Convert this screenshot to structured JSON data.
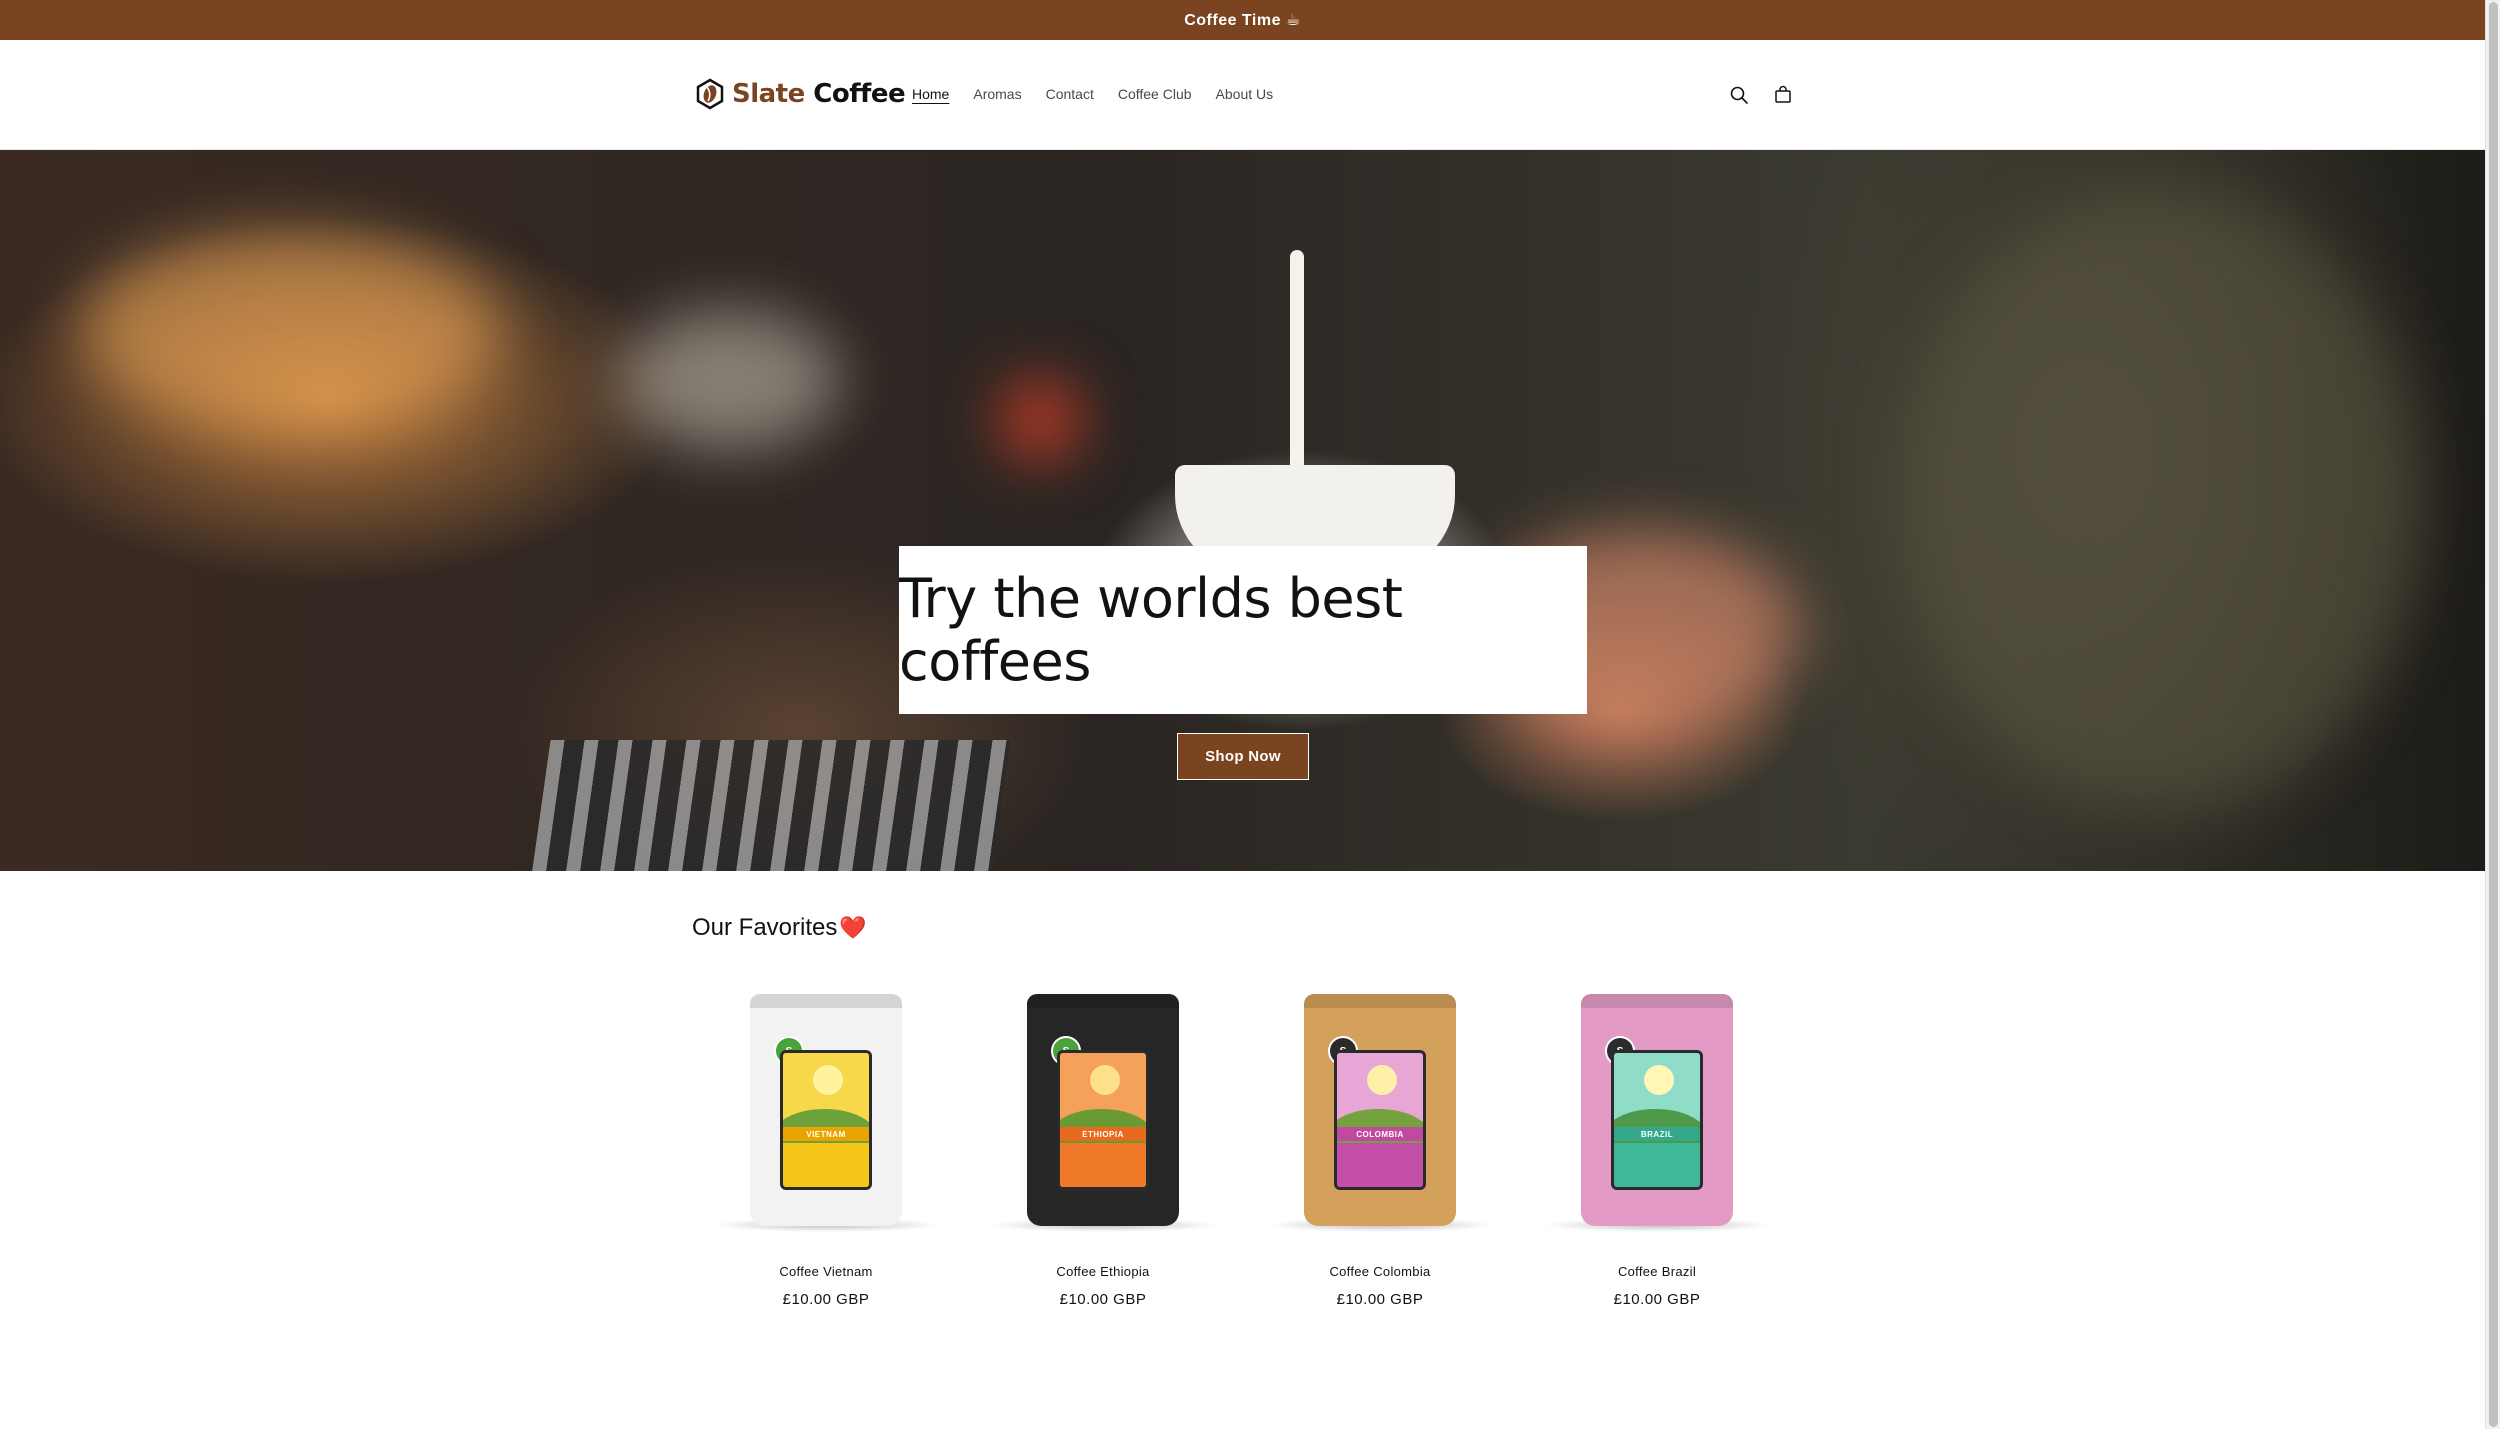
{
  "announcement": {
    "text": "Coffee Time ☕"
  },
  "header": {
    "logo": {
      "brand_accent": "Slate",
      "brand_main": " Coffee"
    },
    "nav": [
      {
        "label": "Home",
        "active": true
      },
      {
        "label": "Aromas",
        "active": false
      },
      {
        "label": "Contact",
        "active": false
      },
      {
        "label": "Coffee Club",
        "active": false
      },
      {
        "label": "About Us",
        "active": false
      }
    ],
    "icons": {
      "search": "search-icon",
      "cart": "cart-icon"
    }
  },
  "hero": {
    "title": "Try the worlds best coffees",
    "button_label": "Shop Now"
  },
  "favorites": {
    "title": "Our Favorites",
    "emoji": "❤️",
    "products": [
      {
        "name": "Coffee Vietnam",
        "price": "£10.00 GBP",
        "label_text": "VIETNAM",
        "bag_color": "#f2f2f2",
        "accent": "#f5c518",
        "sky": "#f7d84a",
        "sun": "#fff3a0",
        "hill": "#6da23a",
        "band": "#e9a400",
        "badge": "#4aa33a"
      },
      {
        "name": "Coffee Ethiopia",
        "price": "£10.00 GBP",
        "label_text": "ETHIOPIA",
        "bag_color": "#262626",
        "accent": "#f07a2a",
        "sky": "#f6a15a",
        "sun": "#ffe08a",
        "hill": "#6a9a34",
        "band": "#e86a1f",
        "badge": "#4aa33a"
      },
      {
        "name": "Coffee Colombia",
        "price": "£10.00 GBP",
        "label_text": "COLOMBIA",
        "bag_color": "#d3a15c",
        "accent": "#c44fa8",
        "sky": "#e7a6d6",
        "sun": "#fff0a8",
        "hill": "#74a23c",
        "band": "#c14aa0",
        "badge": "#2b2b2b"
      },
      {
        "name": "Coffee Brazil",
        "price": "£10.00 GBP",
        "label_text": "BRAZIL",
        "bag_color": "#e39bc6",
        "accent": "#3fb89a",
        "sky": "#8fdcc8",
        "sun": "#fff6b8",
        "hill": "#4f9a4a",
        "band": "#33a98a",
        "badge": "#2b2b2b"
      }
    ]
  },
  "colors": {
    "brand": "#7b4420",
    "text": "#121212"
  }
}
